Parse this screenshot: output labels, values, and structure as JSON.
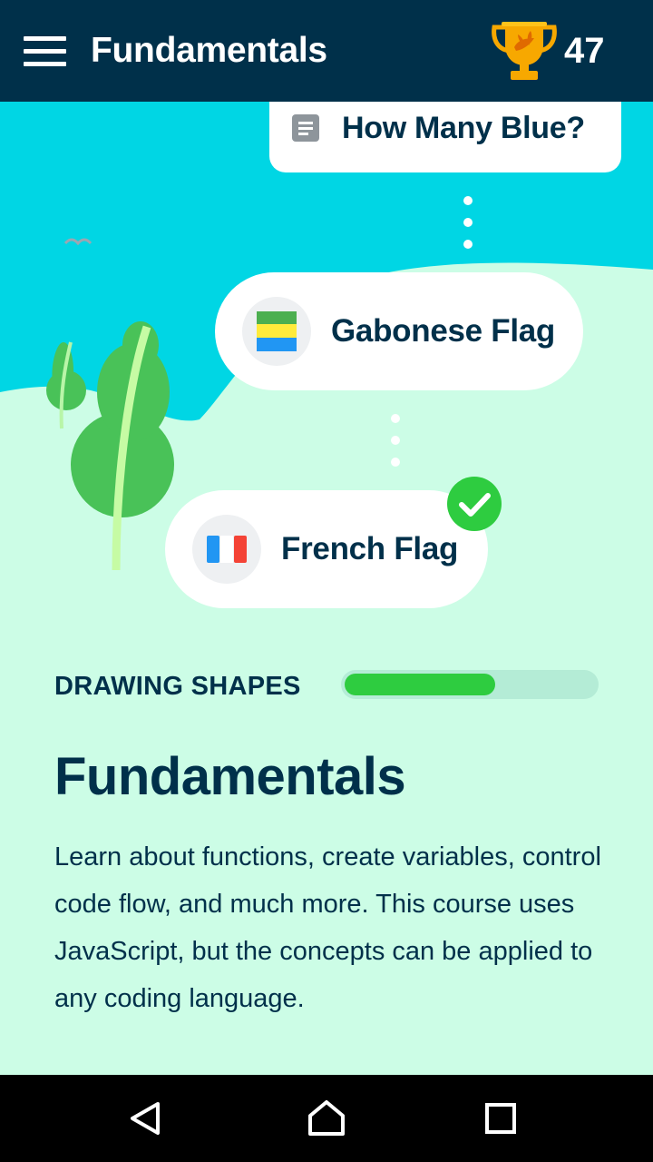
{
  "app": {
    "title": "Fundamentals",
    "score": "47"
  },
  "path": {
    "items": [
      {
        "label": "How Many Blue?",
        "icon": "document-icon",
        "state": "partial"
      },
      {
        "label": "Gabonese Flag",
        "icon": "gabon-flag-icon",
        "state": "available"
      },
      {
        "label": "French Flag",
        "icon": "french-flag-icon",
        "state": "completed"
      }
    ]
  },
  "section": {
    "label": "DRAWING SHAPES",
    "progress": 0.6
  },
  "course": {
    "title": "Fundamentals",
    "description": "Learn about functions, create variables, control code flow, and much more. This course uses JavaScript, but the concepts can be applied to any coding language."
  },
  "colors": {
    "header": "#00304a",
    "sky": "#00d6e4",
    "ground": "#ccfde6",
    "accent_green": "#2ecc40",
    "trophy": "#f7a800"
  },
  "nav": {
    "buttons": [
      "back-icon",
      "home-icon",
      "recents-icon"
    ]
  }
}
